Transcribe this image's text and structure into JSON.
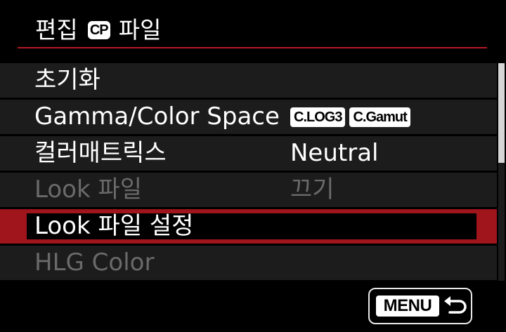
{
  "header": {
    "title_prefix": "편집",
    "cp_badge": "CP",
    "title_suffix": "파일"
  },
  "menu": {
    "items": [
      {
        "label": "초기화",
        "value": "",
        "state": "normal"
      },
      {
        "label": "Gamma/Color Space",
        "tags": [
          "C.LOG3",
          "C.Gamut"
        ],
        "state": "normal"
      },
      {
        "label": "컬러매트릭스",
        "value": "Neutral",
        "state": "normal"
      },
      {
        "label": "Look 파일",
        "value": "끄기",
        "state": "disabled"
      },
      {
        "label": "Look 파일 설정",
        "value": "",
        "state": "selected"
      },
      {
        "label": "HLG Color",
        "value": "",
        "state": "disabled"
      }
    ]
  },
  "footer": {
    "menu_label": "MENU",
    "back_icon": "return-arrow-icon"
  },
  "colors": {
    "accent_red": "#b31a24",
    "row_bg": "#1c1c1c",
    "disabled_text": "#6a6a6a"
  }
}
